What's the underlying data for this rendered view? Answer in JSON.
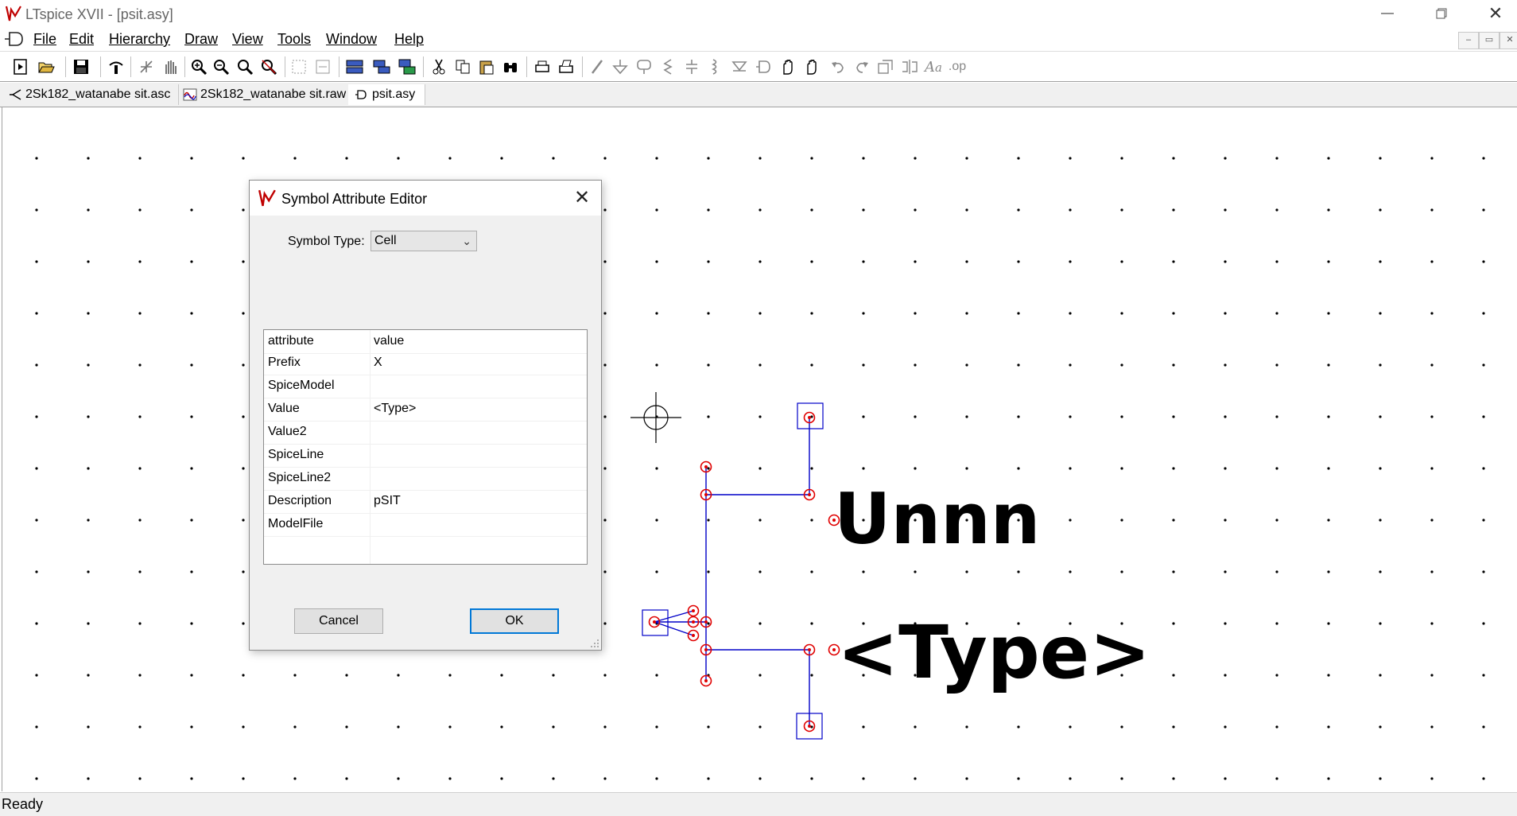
{
  "window": {
    "title": "LTspice XVII - [psit.asy]"
  },
  "menu": {
    "items": [
      "File",
      "Edit",
      "Hierarchy",
      "Draw",
      "View",
      "Tools",
      "Window",
      "Help"
    ]
  },
  "tabs": [
    {
      "label": "2Sk182_watanabe sit.asc",
      "icon": "schematic-icon"
    },
    {
      "label": "2Sk182_watanabe sit.raw",
      "icon": "waveform-icon"
    },
    {
      "label": "psit.asy",
      "icon": "symbol-icon"
    }
  ],
  "toolbar": {
    "icons": [
      "new-icon",
      "open-icon",
      "save-icon",
      "control-panel-icon",
      "run-icon",
      "halt-icon",
      "zoom-in-icon",
      "zoom-out-icon",
      "zoom-back-icon",
      "zoom-fit-icon",
      "autoscale-icon",
      "tile-horizontal-icon",
      "tile-vertical-icon",
      "cascade-icon",
      "cut-icon",
      "copy-icon",
      "paste-icon",
      "find-icon",
      "print-icon",
      "print-setup-icon",
      "draw-wire-icon",
      "ground-icon",
      "label-net-icon",
      "resistor-icon",
      "capacitor-icon",
      "inductor-icon",
      "diode-icon",
      "component-icon",
      "move-icon",
      "drag-icon",
      "undo-icon",
      "redo-icon",
      "rotate-icon",
      "mirror-icon",
      "text-icon",
      "spice-directive-icon"
    ]
  },
  "dialog": {
    "title": "Symbol Attribute Editor",
    "symbol_type_label": "Symbol Type:",
    "symbol_type_value": "Cell",
    "table": {
      "header": {
        "attribute": "attribute",
        "value": "value"
      },
      "rows": [
        {
          "attribute": "Prefix",
          "value": "X"
        },
        {
          "attribute": "SpiceModel",
          "value": ""
        },
        {
          "attribute": "Value",
          "value": "<Type>"
        },
        {
          "attribute": "Value2",
          "value": ""
        },
        {
          "attribute": "SpiceLine",
          "value": ""
        },
        {
          "attribute": "SpiceLine2",
          "value": ""
        },
        {
          "attribute": "Description",
          "value": "pSIT"
        },
        {
          "attribute": "ModelFile",
          "value": ""
        }
      ]
    },
    "cancel_label": "Cancel",
    "ok_label": "OK"
  },
  "canvas": {
    "inst_name_label": "Unnn",
    "value_label": "<Type>",
    "pin_color": "#e00000",
    "line_color": "#0000c8"
  },
  "status": {
    "text": "Ready"
  }
}
